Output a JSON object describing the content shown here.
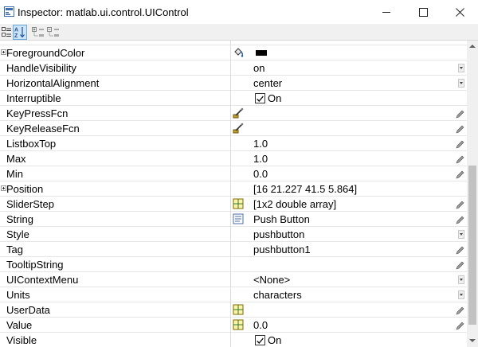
{
  "window": {
    "title": "Inspector:  matlab.ui.control.UIControl",
    "controls": {
      "minimize_icon": "minimize-icon",
      "maximize_icon": "maximize-icon",
      "close_icon": "close-icon"
    }
  },
  "toolbar": {
    "buttons": [
      "categorized-view-icon",
      "sort-alphabetically-icon",
      "expand-all-icon",
      "collapse-all-icon"
    ],
    "active": "sort-alphabetically-icon"
  },
  "colors": {
    "foreground_color_value": "#000000",
    "selected_toolbar_bg": "#cce4f7",
    "scrollbar_thumb": "#c2c2c2"
  },
  "properties": [
    {
      "name": "ForegroundColor",
      "expandable": true,
      "editor": "paint-bucket-icon",
      "value": "",
      "control": "none",
      "swatch": "#000000"
    },
    {
      "name": "HandleVisibility",
      "value": "on",
      "control": "dropdown"
    },
    {
      "name": "HorizontalAlignment",
      "value": "center",
      "control": "dropdown"
    },
    {
      "name": "Interruptible",
      "checked": true,
      "value": "On",
      "control": "checkbox"
    },
    {
      "name": "KeyPressFcn",
      "editor": "function-editor-icon",
      "value": "",
      "control": "pencil"
    },
    {
      "name": "KeyReleaseFcn",
      "editor": "function-editor-icon",
      "value": "",
      "control": "pencil"
    },
    {
      "name": "ListboxTop",
      "value": "1.0",
      "control": "pencil"
    },
    {
      "name": "Max",
      "value": "1.0",
      "control": "pencil"
    },
    {
      "name": "Min",
      "value": "0.0",
      "control": "pencil"
    },
    {
      "name": "Position",
      "expandable": true,
      "value": "[16 21.227 41.5 5.864]",
      "control": "none"
    },
    {
      "name": "SliderStep",
      "editor": "array-editor-icon",
      "value": "[1x2  double array]",
      "control": "pencil"
    },
    {
      "name": "String",
      "editor": "text-editor-icon",
      "value": "Push Button",
      "control": "pencil"
    },
    {
      "name": "Style",
      "value": "pushbutton",
      "control": "dropdown"
    },
    {
      "name": "Tag",
      "value": "pushbutton1",
      "control": "pencil"
    },
    {
      "name": "TooltipString",
      "value": "",
      "control": "pencil"
    },
    {
      "name": "UIContextMenu",
      "value": "<None>",
      "control": "dropdown"
    },
    {
      "name": "Units",
      "value": "characters",
      "control": "dropdown"
    },
    {
      "name": "UserData",
      "editor": "array-editor-icon",
      "value": "",
      "control": "pencil"
    },
    {
      "name": "Value",
      "editor": "array-editor-icon",
      "value": "0.0",
      "control": "pencil"
    },
    {
      "name": "Visible",
      "checked": true,
      "value": "On",
      "control": "checkbox"
    }
  ]
}
